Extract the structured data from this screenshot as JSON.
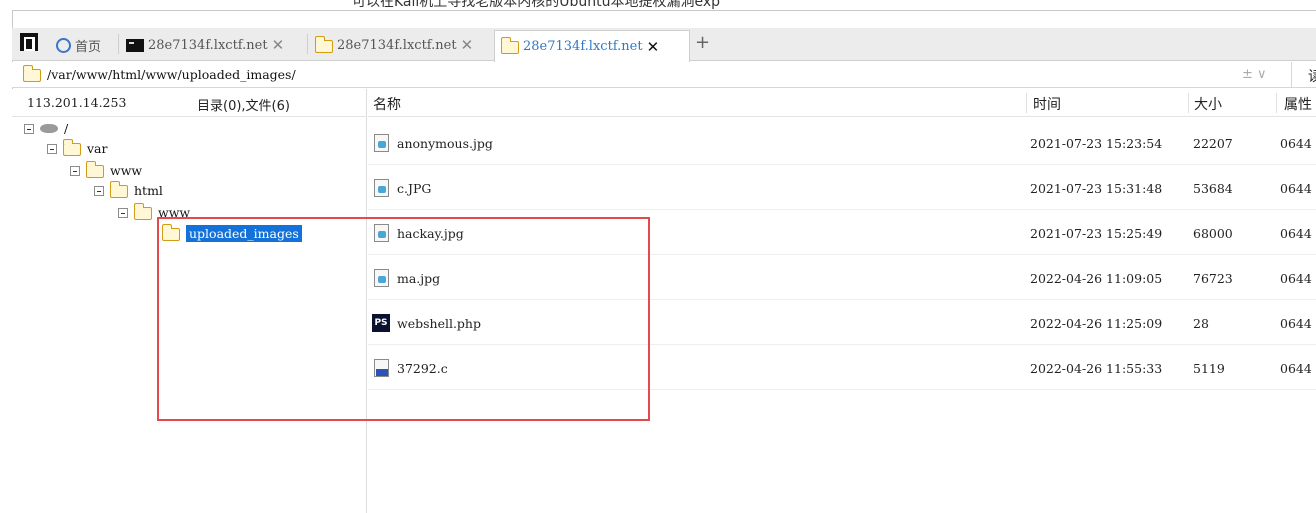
{
  "top_caption": "可以在Kali机上寻找老版本内核的Ubuntu本地提权漏洞exp",
  "tabs": [
    {
      "label": "首页",
      "icon": "home-icon",
      "active": false
    },
    {
      "label": "28e7134f.lxctf.net",
      "icon": "terminal-icon",
      "active": false
    },
    {
      "label": "28e7134f.lxctf.net",
      "icon": "folder-icon",
      "active": false
    },
    {
      "label": "28e7134f.lxctf.net",
      "icon": "folder-icon",
      "active": true
    }
  ],
  "new_tab_label": "+",
  "address": {
    "path": "/var/www/html/www/uploaded_images/",
    "controls": "± ∨",
    "read_button": "读"
  },
  "left_pane": {
    "host_ip": "113.201.14.253",
    "counts": "目录(0),文件(6)",
    "tree": [
      {
        "label": "/",
        "type": "drive"
      },
      {
        "label": "var",
        "type": "folder"
      },
      {
        "label": "www",
        "type": "folder"
      },
      {
        "label": "html",
        "type": "folder"
      },
      {
        "label": "www",
        "type": "folder"
      },
      {
        "label": "uploaded_images",
        "type": "folder",
        "selected": true
      }
    ]
  },
  "file_table": {
    "columns": {
      "name": "名称",
      "time": "时间",
      "size": "大小",
      "attr": "属性"
    },
    "rows": [
      {
        "name": "anonymous.jpg",
        "icon": "image-file-icon",
        "time": "2021-07-23 15:23:54",
        "size": "22207",
        "attr": "0644"
      },
      {
        "name": "c.JPG",
        "icon": "image-file-icon",
        "time": "2021-07-23 15:31:48",
        "size": "53684",
        "attr": "0644"
      },
      {
        "name": "hackay.jpg",
        "icon": "image-file-icon",
        "time": "2021-07-23 15:25:49",
        "size": "68000",
        "attr": "0644"
      },
      {
        "name": "ma.jpg",
        "icon": "image-file-icon",
        "time": "2022-04-26 11:09:05",
        "size": "76723",
        "attr": "0644"
      },
      {
        "name": "webshell.php",
        "icon": "php-file-icon",
        "time": "2022-04-26 11:25:09",
        "size": "28",
        "attr": "0644"
      },
      {
        "name": "37292.c",
        "icon": "c-file-icon",
        "time": "2022-04-26 11:55:33",
        "size": "5119",
        "attr": "0644"
      }
    ]
  },
  "colors": {
    "active_tab_text": "#2f79c8",
    "selection": "#1272d9",
    "highlight_box": "#e5484d"
  }
}
